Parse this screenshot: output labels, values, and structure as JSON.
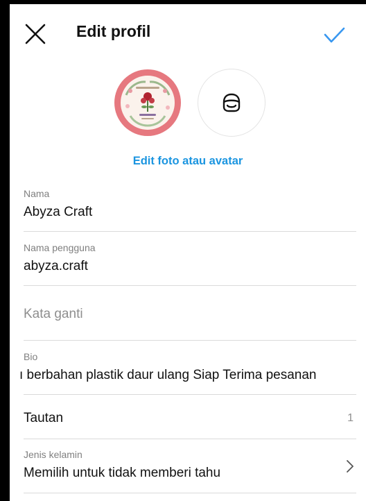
{
  "header": {
    "title": "Edit profil",
    "close_icon": "close-icon",
    "confirm_icon": "checkmark-icon",
    "confirm_color": "#3897f0"
  },
  "photo": {
    "edit_label": "Edit foto atau avatar",
    "ring_color": "#e6787f",
    "avatar_icon": "avatar-face-icon"
  },
  "fields": {
    "name": {
      "label": "Nama",
      "value": "Abyza Craft"
    },
    "username": {
      "label": "Nama pengguna",
      "value": "abyza.craft"
    },
    "pronouns": {
      "placeholder": "Kata ganti"
    },
    "bio": {
      "label": "Bio",
      "value": "ı berbahan plastik daur ulang  Siap Terima pesanan"
    },
    "links": {
      "label": "Tautan",
      "count": "1"
    },
    "gender": {
      "label": "Jenis kelamin",
      "value": "Memilih untuk tidak memberi tahu"
    }
  },
  "colors": {
    "link": "#1b95e0",
    "text": "#111111",
    "muted": "#8e8e8e"
  }
}
